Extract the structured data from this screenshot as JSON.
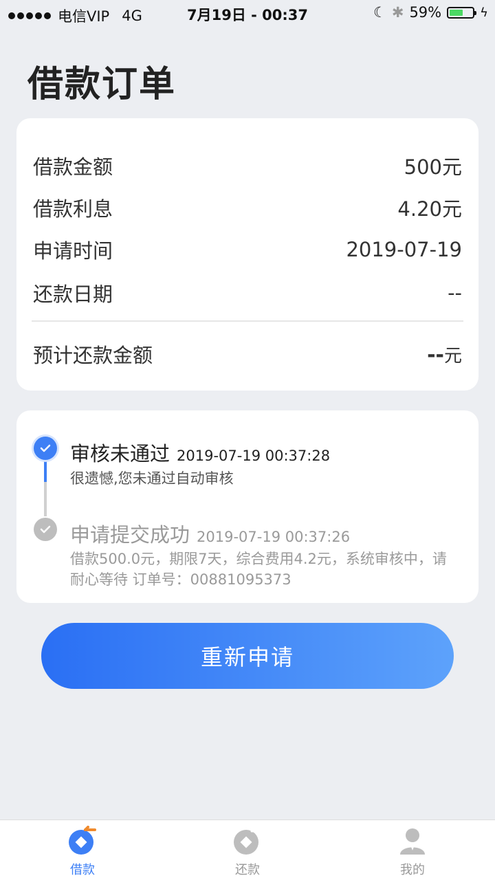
{
  "status_bar": {
    "carrier": "电信VIP",
    "network": "4G",
    "datetime": "7月19日 - 00:37",
    "battery_percent": "59%",
    "battery_level": 0.59
  },
  "page": {
    "title": "借款订单"
  },
  "summary": {
    "rows": [
      {
        "label": "借款金额",
        "value": "500元"
      },
      {
        "label": "借款利息",
        "value": "4.20元"
      },
      {
        "label": "申请时间",
        "value": "2019-07-19"
      },
      {
        "label": "还款日期",
        "value": "--"
      }
    ],
    "total_label": "预计还款金额",
    "total_value": "--",
    "total_unit": "元"
  },
  "timeline": [
    {
      "title": "审核未通过",
      "time": "2019-07-19 00:37:28",
      "desc": "很遗憾,您未通过自动审核"
    },
    {
      "title": "申请提交成功",
      "time": "2019-07-19 00:37:26",
      "desc": "借款500.0元，期限7天，综合费用4.2元，系统审核中，请耐心等待 订单号：00881095373"
    }
  ],
  "actions": {
    "reapply_label": "重新申请"
  },
  "tabbar": {
    "items": [
      {
        "label": "借款",
        "icon": "loan-icon"
      },
      {
        "label": "还款",
        "icon": "repay-icon"
      },
      {
        "label": "我的",
        "icon": "profile-icon"
      }
    ]
  },
  "colors": {
    "accent": "#3d7ff5",
    "button_start": "#2a6ff4",
    "button_end": "#5da2fb",
    "inactive": "#bdbdbd"
  }
}
